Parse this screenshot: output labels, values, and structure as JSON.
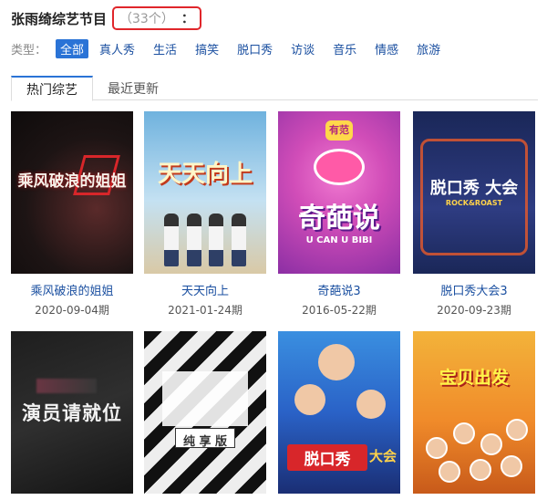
{
  "header": {
    "title": "张雨绮综艺节目",
    "count": "（33个）",
    "count_suffix": "："
  },
  "filter": {
    "label": "类型：",
    "items": [
      "全部",
      "真人秀",
      "生活",
      "搞笑",
      "脱口秀",
      "访谈",
      "音乐",
      "情感",
      "旅游"
    ],
    "active": "全部"
  },
  "tabs": [
    {
      "label": "热门综艺",
      "active": true
    },
    {
      "label": "最近更新",
      "active": false
    }
  ],
  "shows": [
    {
      "title": "乘风破浪的姐姐",
      "date": "2020-09-04期",
      "poster_text": "乘风破浪的姐姐"
    },
    {
      "title": "天天向上",
      "date": "2021-01-24期",
      "poster_text": "天天向上"
    },
    {
      "title": "奇葩说3",
      "date": "2016-05-22期",
      "poster_text": "奇葩说",
      "poster_badge": "有范",
      "poster_sub": "U CAN U BIBI"
    },
    {
      "title": "脱口秀大会3",
      "date": "2020-09-23期",
      "poster_text": "脱口秀 大会",
      "poster_sub": "ROCK&ROAST"
    },
    {
      "title": "",
      "date": "",
      "poster_text": "演员请就位"
    },
    {
      "title": "",
      "date": "",
      "poster_text": "纯 享 版"
    },
    {
      "title": "",
      "date": "",
      "poster_text": "脱口秀",
      "poster_text_2": "大会"
    },
    {
      "title": "",
      "date": "",
      "poster_text": "宝贝出发"
    }
  ],
  "colors": {
    "link": "#1a4fa0",
    "active_filter": "#2a73d6",
    "highlight_box": "#e0262b"
  }
}
